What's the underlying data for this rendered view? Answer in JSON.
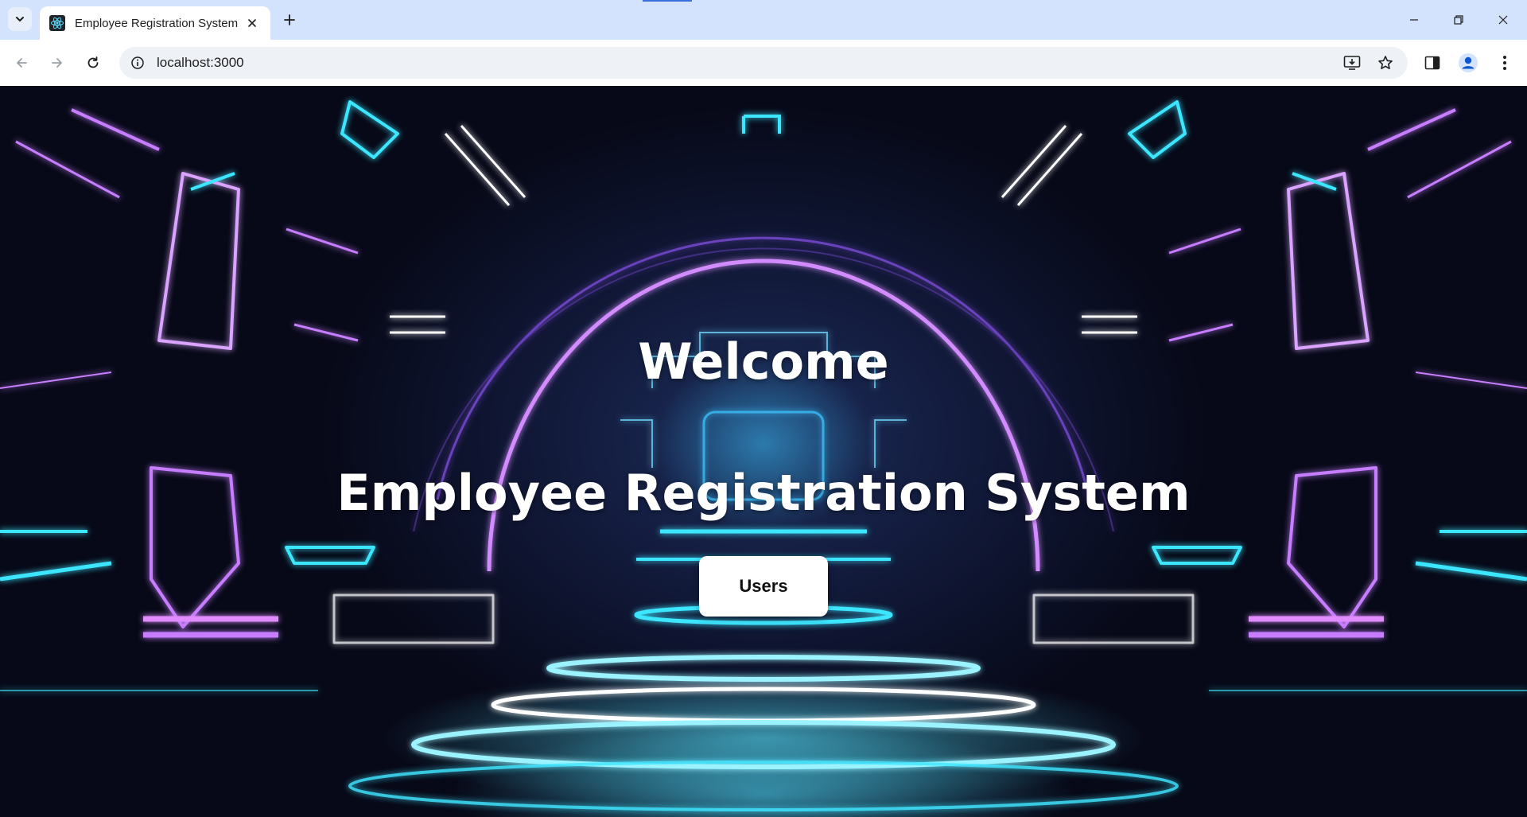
{
  "browser": {
    "tab": {
      "title": "Employee Registration System",
      "favicon": "react-logo-icon"
    },
    "address_bar": {
      "url": "localhost:3000"
    },
    "icons": {
      "tab_search": "chevron-down-icon",
      "new_tab": "plus-icon",
      "minimize": "minimize-icon",
      "restore": "restore-icon",
      "close": "close-icon",
      "back": "arrow-left-icon",
      "forward": "arrow-right-icon",
      "reload": "reload-icon",
      "site_info": "info-icon",
      "install": "install-app-icon",
      "bookmark": "star-icon",
      "side_panel": "side-panel-icon",
      "profile": "profile-icon",
      "menu": "kebab-menu-icon"
    }
  },
  "page": {
    "welcome": "Welcome",
    "title": "Employee Registration System",
    "users_button": "Users"
  },
  "colors": {
    "tabstrip": "#d3e3fd",
    "neon_purple": "#c77dff",
    "neon_cyan": "#3ee6ff",
    "button_bg": "#ffffff"
  }
}
